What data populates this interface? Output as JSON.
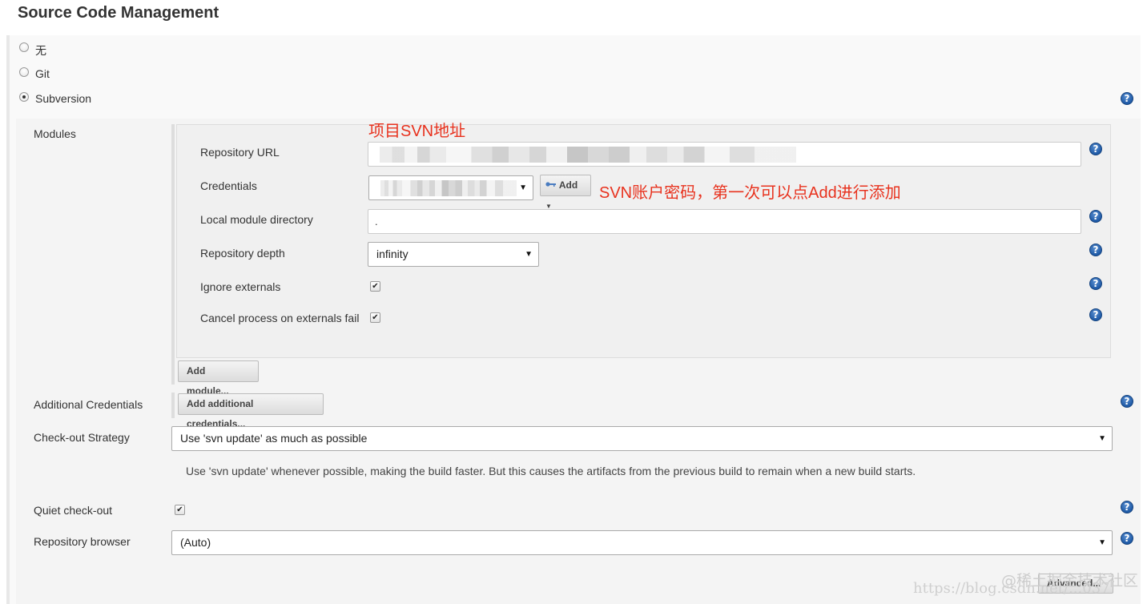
{
  "section": {
    "title": "Source Code Management"
  },
  "scm_options": [
    {
      "label": "无",
      "selected": false
    },
    {
      "label": "Git",
      "selected": false
    },
    {
      "label": "Subversion",
      "selected": true
    }
  ],
  "modules": {
    "label": "Modules",
    "repository_url": {
      "label": "Repository URL",
      "value": ""
    },
    "credentials": {
      "label": "Credentials",
      "selected": "",
      "add_button": "Add"
    },
    "local_module_directory": {
      "label": "Local module directory",
      "value": "."
    },
    "repository_depth": {
      "label": "Repository depth",
      "selected": "infinity"
    },
    "ignore_externals": {
      "label": "Ignore externals",
      "checked": true
    },
    "cancel_process": {
      "label": "Cancel process on externals fail",
      "checked": true
    },
    "add_module_button": "Add module..."
  },
  "additional_credentials": {
    "label": "Additional Credentials",
    "button": "Add additional credentials..."
  },
  "checkout_strategy": {
    "label": "Check-out Strategy",
    "selected": "Use 'svn update' as much as possible",
    "description": "Use 'svn update' whenever possible, making the build faster. But this causes the artifacts from the previous build to remain when a new build starts."
  },
  "quiet_checkout": {
    "label": "Quiet check-out",
    "checked": true
  },
  "repository_browser": {
    "label": "Repository browser",
    "selected": "(Auto)"
  },
  "advanced_button": "Advanced...",
  "annotations": {
    "svn_address": "项目SVN地址",
    "svn_account": "SVN账户密码，第一次可以点Add进行添加"
  },
  "watermarks": {
    "url": "https://blog.csdn.net/...037",
    "juejin": "@稀土掘金技术社区"
  },
  "icons": {
    "help": "help-icon",
    "dropdown": "dropdown-arrow-icon",
    "key": "key-icon",
    "check": "checkmark-icon"
  },
  "help_glyph": "?",
  "check_glyph": "✔",
  "arrow_glyph": "▼",
  "colors": {
    "annotation": "#e8321e",
    "help_icon": "#1f5aa6"
  }
}
